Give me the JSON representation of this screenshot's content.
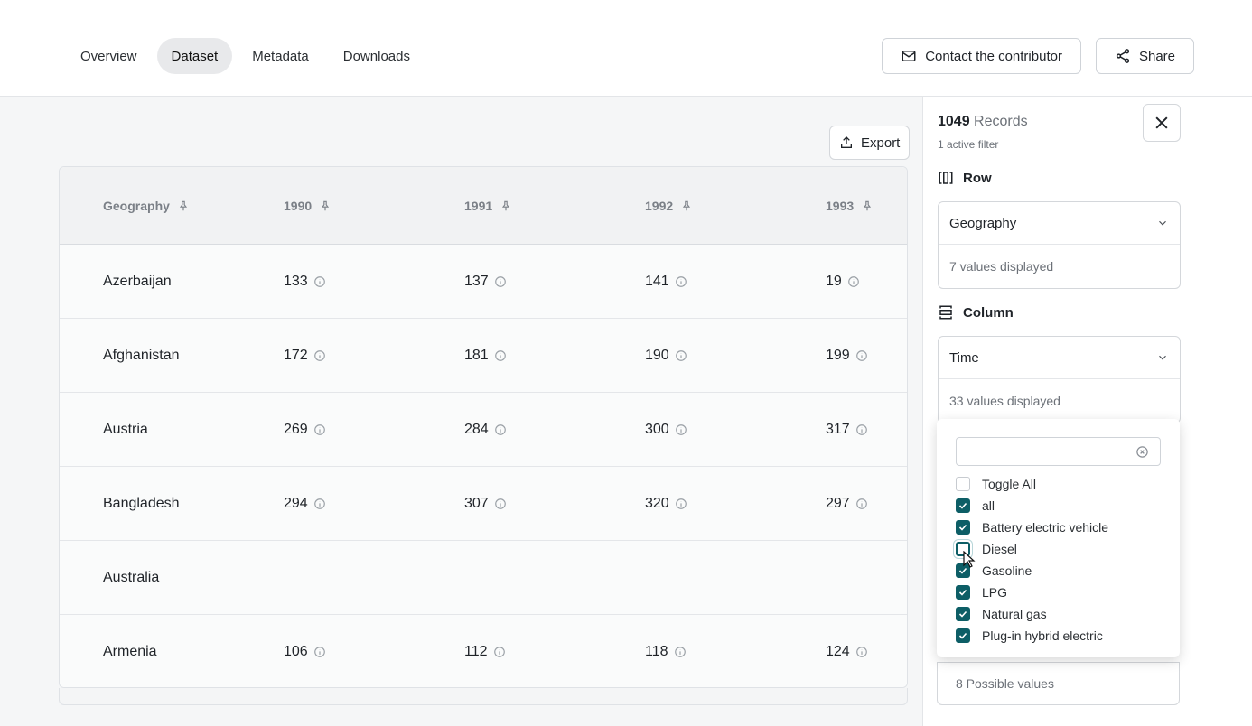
{
  "tabs": [
    {
      "label": "Overview",
      "active": false
    },
    {
      "label": "Dataset",
      "active": true
    },
    {
      "label": "Metadata",
      "active": false
    },
    {
      "label": "Downloads",
      "active": false
    }
  ],
  "actions": {
    "contact_label": "Contact the contributor",
    "share_label": "Share",
    "export_label": "Export"
  },
  "table": {
    "headers": [
      "Geography",
      "1990",
      "1991",
      "1992",
      "1993"
    ],
    "rows": [
      {
        "geo": "Azerbaijan",
        "values": [
          "133",
          "137",
          "141",
          "19"
        ]
      },
      {
        "geo": "Afghanistan",
        "values": [
          "172",
          "181",
          "190",
          "199"
        ]
      },
      {
        "geo": "Austria",
        "values": [
          "269",
          "284",
          "300",
          "317"
        ]
      },
      {
        "geo": "Bangladesh",
        "values": [
          "294",
          "307",
          "320",
          "297"
        ]
      },
      {
        "geo": "Australia",
        "values": [
          "",
          "",
          "",
          ""
        ]
      },
      {
        "geo": "Armenia",
        "values": [
          "106",
          "112",
          "118",
          "124"
        ]
      }
    ]
  },
  "panel": {
    "records_count": "1049",
    "records_label": "Records",
    "active_filter": "1 active filter",
    "row_label": "Row",
    "row_select": "Geography",
    "row_displayed": "7 values displayed",
    "column_label": "Column",
    "column_select": "Time",
    "column_displayed": "33 values displayed",
    "possible_values": "8 Possible values"
  },
  "filter_options": [
    {
      "label": "Toggle All",
      "checked": false
    },
    {
      "label": "all",
      "checked": true
    },
    {
      "label": "Battery electric vehicle",
      "checked": true
    },
    {
      "label": "Diesel",
      "checked": false,
      "focused": true
    },
    {
      "label": "Gasoline",
      "checked": true
    },
    {
      "label": "LPG",
      "checked": true
    },
    {
      "label": "Natural gas",
      "checked": true
    },
    {
      "label": "Plug-in hybrid electric",
      "checked": true
    }
  ],
  "colors": {
    "accent": "#0d5e66",
    "active_tab_bg": "#e8e9eb",
    "muted_text": "#6c7178"
  }
}
